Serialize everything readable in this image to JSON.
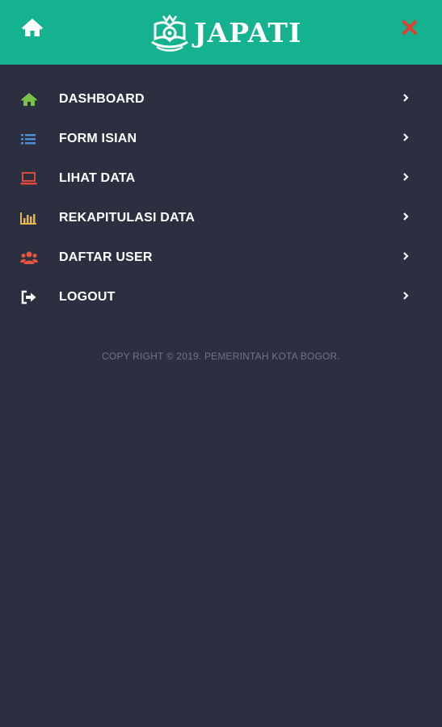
{
  "header": {
    "brand": "JAPATI",
    "home_icon": "home-icon",
    "close_icon": "close-icon",
    "colors": {
      "background": "#15b28f",
      "close": "#e0402e"
    }
  },
  "menu": {
    "items": [
      {
        "label": "DASHBOARD",
        "icon": "home-icon",
        "color": "#7cc24a"
      },
      {
        "label": "FORM ISIAN",
        "icon": "list-icon",
        "color": "#4d8fd6"
      },
      {
        "label": "LIHAT DATA",
        "icon": "laptop-icon",
        "color": "#e0483a"
      },
      {
        "label": "REKAPITULASI DATA",
        "icon": "bar-chart-icon",
        "color": "#e8b347"
      },
      {
        "label": "DAFTAR USER",
        "icon": "users-icon",
        "color": "#e5553f"
      },
      {
        "label": "LOGOUT",
        "icon": "sign-out-icon",
        "color": "#ffffff"
      }
    ]
  },
  "footer": {
    "copyright": "COPY RIGHT © 2019. PEMERINTAH KOTA BOGOR."
  },
  "colors": {
    "page_background": "#2b2f3f",
    "footer_text": "#6f7586"
  }
}
